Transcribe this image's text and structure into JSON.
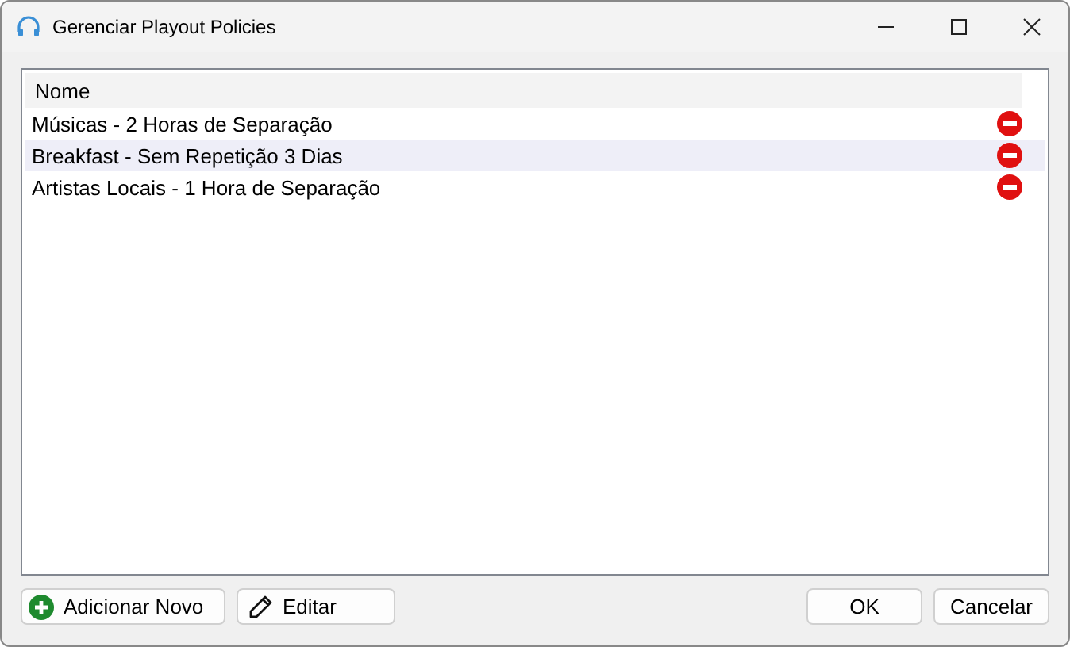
{
  "window": {
    "title": "Gerenciar Playout Policies"
  },
  "list": {
    "columns": [
      "Nome"
    ],
    "rows": [
      {
        "name": "Músicas - 2 Horas de Separação",
        "selected": false
      },
      {
        "name": "Breakfast - Sem Repetição 3 Dias",
        "selected": true
      },
      {
        "name": "Artistas Locais - 1 Hora de Separação",
        "selected": false
      }
    ]
  },
  "buttons_left": [
    {
      "label": "Adicionar Novo",
      "kind": "add"
    },
    {
      "label": "Editar",
      "kind": "edit"
    }
  ],
  "buttons_right": [
    {
      "label": "OK"
    },
    {
      "label": "Cancelar"
    }
  ]
}
